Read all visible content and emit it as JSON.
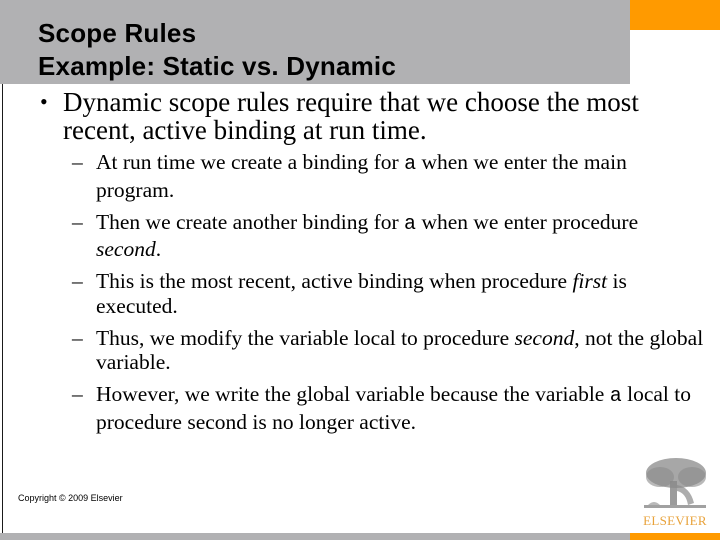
{
  "slide": {
    "title_lines": [
      "Scope Rules",
      "Example: Static vs. Dynamic"
    ],
    "bullet": {
      "marker": "•",
      "text": "Dynamic scope rules require that we choose the most recent, active binding at run time."
    },
    "sub_bullets": [
      {
        "marker": "–",
        "parts": [
          {
            "t": "At run time we create a binding for ",
            "style": "normal"
          },
          {
            "t": "a",
            "style": "code"
          },
          {
            "t": " when we enter the main program.",
            "style": "normal"
          }
        ]
      },
      {
        "marker": "–",
        "parts": [
          {
            "t": "Then we create another binding for ",
            "style": "normal"
          },
          {
            "t": "a",
            "style": "code"
          },
          {
            "t": " when we enter procedure ",
            "style": "normal"
          },
          {
            "t": "second",
            "style": "italic"
          },
          {
            "t": ".",
            "style": "normal"
          }
        ]
      },
      {
        "marker": "–",
        "parts": [
          {
            "t": "This is the most recent, active binding when procedure ",
            "style": "normal"
          },
          {
            "t": "first",
            "style": "italic"
          },
          {
            "t": " is executed.",
            "style": "normal"
          }
        ]
      },
      {
        "marker": "–",
        "parts": [
          {
            "t": "Thus, we modify the variable local to procedure ",
            "style": "normal"
          },
          {
            "t": "second",
            "style": "italic"
          },
          {
            "t": ", not the global variable.",
            "style": "normal"
          }
        ]
      },
      {
        "marker": "–",
        "parts": [
          {
            "t": "However, we write the global variable because the variable ",
            "style": "normal"
          },
          {
            "t": "a",
            "style": "code"
          },
          {
            "t": " local to procedure second is no longer active.",
            "style": "normal"
          }
        ]
      }
    ],
    "copyright": "Copyright © 2009 Elsevier",
    "logo_text": "ELSEVIER"
  },
  "colors": {
    "header_grey": "#b1b1b3",
    "accent_orange": "#ff9a00",
    "logo_text": "#e8a23a"
  },
  "icons": {
    "logo": "elsevier-tree-logo-icon"
  }
}
